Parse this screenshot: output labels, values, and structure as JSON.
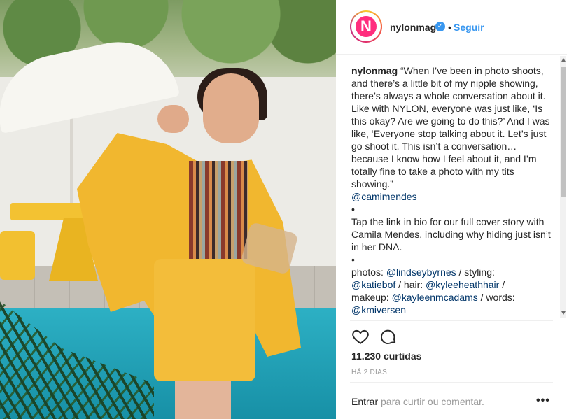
{
  "post": {
    "username": "nylonmag",
    "avatar_letter": "N",
    "separator": "•",
    "follow_label": "Seguir",
    "caption_lines": [
      "“When I’ve been in photo shoots, and there’s a little bit of my nipple showing, there’s always a whole conversation about it. Like with NYLON, everyone was just like, ‘Is this okay? Are we going to do this?’ And I was like, ‘Everyone stop talking about it. Let’s just go shoot it. This isn’t a conversation… because I know how I feel about it, and I’m totally fine to take a photo with my tits showing.” —"
    ],
    "mention_author": "@camimendes",
    "bullet": "•",
    "cta_text": "Tap the link in bio for our full cover story with Camila Mendes, including why hiding just isn’t in her DNA.",
    "bullet2": "•",
    "credits": {
      "photos_label": "photos: ",
      "photos": "@lindseybyrnes",
      "styling_label": " / styling:",
      "styling": "@katiebof",
      "hair_label": " / hair: ",
      "hair": "@kyleeheathhair",
      "hair_sep": " /",
      "makeup_label": "makeup: ",
      "makeup": "@kayleenmcadams",
      "words_label": " / words:",
      "words": "@kmiversen"
    },
    "likes": "11.230 curtidas",
    "time": "HÁ 2 DIAS",
    "login_link": "Entrar",
    "login_rest": " para curtir ou comentar.",
    "more_label": "•••"
  },
  "icons": {
    "verified": "verified-badge-icon",
    "like": "heart-icon",
    "comment": "comment-icon",
    "more": "more-options-icon"
  },
  "colors": {
    "link": "#003569",
    "follow": "#3897f0",
    "text": "#262626",
    "muted": "#999999",
    "brand": "#ff2e7e"
  }
}
